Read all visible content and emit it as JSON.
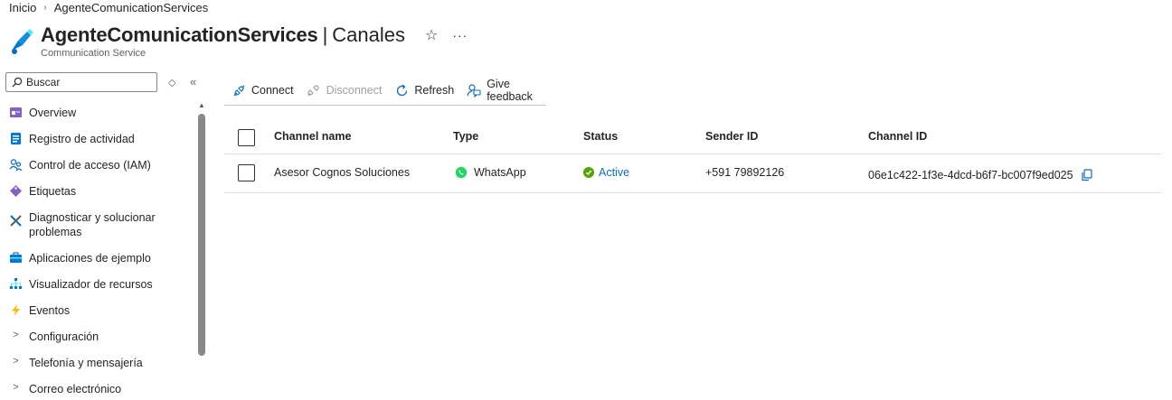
{
  "breadcrumb": {
    "home": "Inicio",
    "current": "AgenteComunicationServices"
  },
  "header": {
    "resource_name": "AgenteComunicationServices",
    "separator": "|",
    "page": "Canales",
    "resource_type": "Communication Service",
    "favorite_icon": "star-icon",
    "more_icon": "ellipsis-icon"
  },
  "search": {
    "placeholder": "Buscar"
  },
  "sidebar": {
    "items": [
      {
        "label": "Overview",
        "icon": "overview-icon"
      },
      {
        "label": "Registro de actividad",
        "icon": "activity-log-icon"
      },
      {
        "label": "Control de acceso (IAM)",
        "icon": "people-icon"
      },
      {
        "label": "Etiquetas",
        "icon": "tag-icon"
      },
      {
        "label": "Diagnosticar y solucionar problemas",
        "icon": "wrench-icon"
      },
      {
        "label": "Aplicaciones de ejemplo",
        "icon": "app-briefcase-icon"
      },
      {
        "label": "Visualizador de recursos",
        "icon": "resource-tree-icon"
      },
      {
        "label": "Eventos",
        "icon": "lightning-icon"
      },
      {
        "label": "Configuración",
        "icon": "chevron-right-icon"
      },
      {
        "label": "Telefonía y mensajería",
        "icon": "chevron-right-icon"
      },
      {
        "label": "Correo electrónico",
        "icon": "chevron-right-icon"
      }
    ]
  },
  "toolbar": {
    "connect": "Connect",
    "disconnect": "Disconnect",
    "refresh": "Refresh",
    "feedback": "Give feedback"
  },
  "table": {
    "columns": [
      "Channel name",
      "Type",
      "Status",
      "Sender ID",
      "Channel ID"
    ],
    "rows": [
      {
        "channel_name": "Asesor Cognos Soluciones",
        "type": "WhatsApp",
        "status": "Active",
        "sender_id": "+591 79892126",
        "channel_id": "06e1c422-1f3e-4dcd-b6f7-bc007f9ed025"
      }
    ]
  },
  "colors": {
    "accent": "#0f6cbd",
    "active_green": "#57a300",
    "whatsapp_green": "#25d366"
  }
}
